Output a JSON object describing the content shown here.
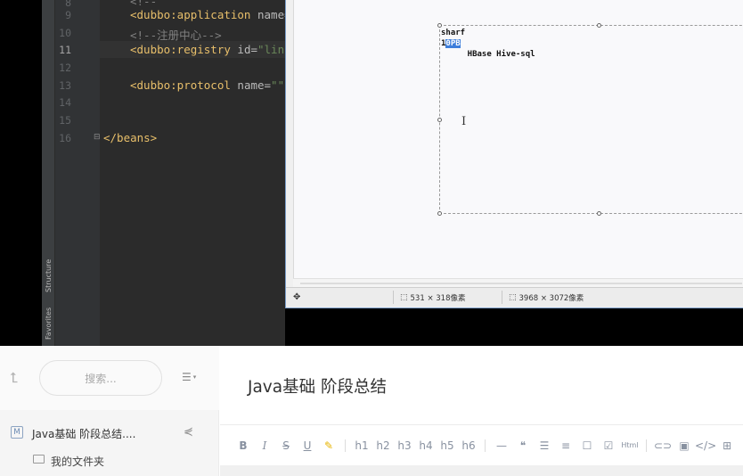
{
  "ide": {
    "side_tabs": [
      "Structure",
      "Favorites"
    ],
    "lines": [
      {
        "num": "8",
        "text": ""
      },
      {
        "num": "9",
        "text": ""
      },
      {
        "num": "10",
        "text": ""
      },
      {
        "num": "11",
        "text": ""
      },
      {
        "num": "12",
        "text": ""
      },
      {
        "num": "13",
        "text": ""
      },
      {
        "num": "14",
        "text": ""
      },
      {
        "num": "15",
        "text": ""
      },
      {
        "num": "16",
        "text": ""
      }
    ],
    "code": {
      "l9_tag": "<dubbo:application",
      "l9_rest": " name=",
      "l10": "<!--注册中心-->",
      "l11_tag": "<dubbo:registry",
      "l11_attr": " id=",
      "l11_str": "\"linu",
      "l13_tag": "<dubbo:protocol",
      "l13_attr": " name=",
      "l13_str": "\"\",",
      "l16": "</beans>"
    }
  },
  "viewer": {
    "image_text": {
      "line1": "sharf",
      "line2_prefix": "1",
      "line2_sel": "0PB",
      "line3": "    HBase Hive-sql"
    },
    "status": {
      "selection_size": "531 × 318像素",
      "image_size": "3968 × 3072像素"
    }
  },
  "note": {
    "search_placeholder": "搜索...",
    "note_item_title": "Java基础 阶段总结....",
    "folder_label": "我的文件夹",
    "doc_title": "Java基础 阶段总结",
    "toolbar": [
      "B",
      "I",
      "S",
      "U",
      "h1",
      "h2",
      "h3",
      "h4",
      "h5",
      "h6",
      "Html"
    ]
  }
}
